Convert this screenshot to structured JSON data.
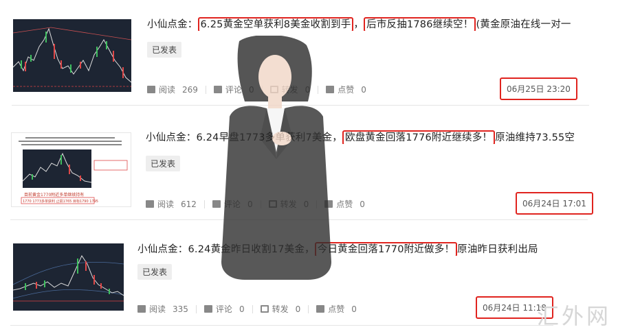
{
  "articles": [
    {
      "title_prefix": "小仙点金：",
      "title_hl1": "6.25黄金空单获利8美金收割到手",
      "title_mid": "，",
      "title_hl2": "后市反抽1786继续空！",
      "title_suffix": "(黄金原油在线一对一",
      "status": "已发表",
      "reads_label": "阅读",
      "reads": "269",
      "comments_label": "评论",
      "comments": "0",
      "reposts_label": "转发",
      "reposts": "0",
      "likes_label": "点赞",
      "likes": "0",
      "date": "06月25日 23:20"
    },
    {
      "title_prefix": "小仙点金：6.24早盘1773多单获利7美金，",
      "title_hl1": "欧盘黄金回落1776附近继续多！",
      "title_suffix": "原油维持73.55空",
      "status": "已发表",
      "reads_label": "阅读",
      "reads": "612",
      "comments_label": "评论",
      "comments": "0",
      "reposts_label": "转发",
      "reposts": "0",
      "likes_label": "点赞",
      "likes": "0",
      "date": "06月24日 17:01"
    },
    {
      "title_prefix": "小仙点金：6.24黄金昨日收割17美金，",
      "title_hl1": "今日黄金回落1770附近做多！",
      "title_suffix": "原油昨日获利出局，反",
      "status": "已发表",
      "reads_label": "阅读",
      "reads": "335",
      "comments_label": "评论",
      "comments": "0",
      "reposts_label": "转发",
      "reposts": "0",
      "likes_label": "点赞",
      "likes": "0",
      "date": "06月24日 11:18"
    }
  ],
  "thumb2_texts": [
    "目前黄金1770附近多单继续持有",
    "1770 1773多单获利 止损1765 目标1790 1795"
  ],
  "watermark": "汇外网"
}
